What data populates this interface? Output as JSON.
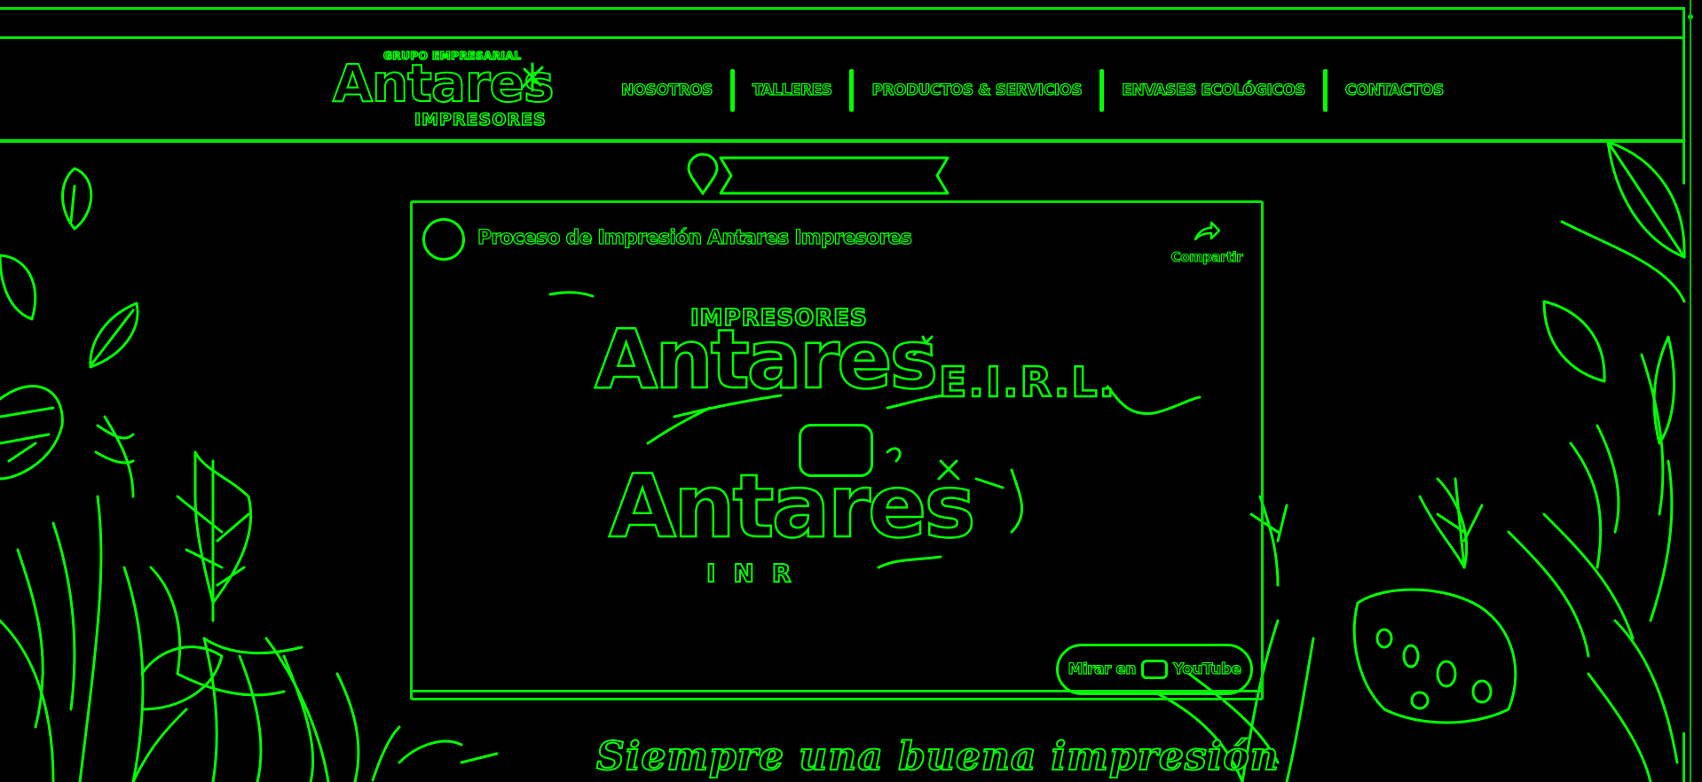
{
  "logo": {
    "top_text": "GRUPO EMPRESARIAL",
    "main_text": "Antares",
    "sub_text": "IMPRESORES"
  },
  "nav": {
    "items": [
      {
        "label": "NOSOTROS"
      },
      {
        "label": "TALLERES"
      },
      {
        "label": "PRODUCTOS & SERVICIOS"
      },
      {
        "label": "ENVASES ECOLÓGICOS"
      },
      {
        "label": "CONTACTOS"
      }
    ]
  },
  "video": {
    "title": "Proceso de Impresión Antares Impresores",
    "share_label": "Compartir",
    "watch_on_label": "Mirar en",
    "youtube_label": "YouTube",
    "thumbnail": {
      "small_text": "IMPRESORES",
      "big_text": "Antares",
      "suffix_text": "E.I.R.L.",
      "second_text": "Antares",
      "tiny_text": "INR"
    }
  },
  "tagline": "Siempre una buena impresión",
  "colors": {
    "background": "#000000",
    "accent": "#00ff00"
  },
  "icons": {
    "location": "map-pin-icon",
    "share": "share-arrow-icon",
    "play": "play-button-icon",
    "youtube": "youtube-logo-icon"
  }
}
